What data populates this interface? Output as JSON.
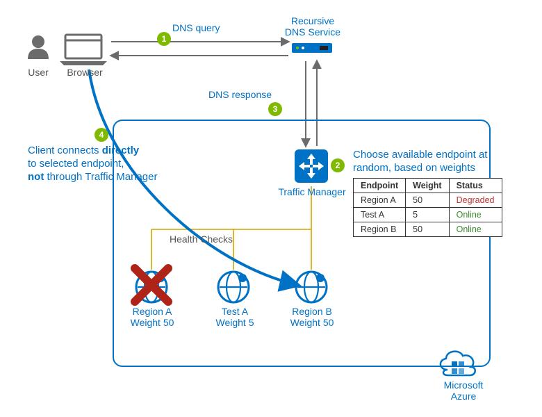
{
  "colors": {
    "azure_blue": "#0072c6",
    "accent_green": "#7fba00",
    "gray": "#6b6b6b",
    "cross_red": "#b02318",
    "degraded": "#c0322f",
    "online": "#3b8a2e"
  },
  "actors": {
    "user": "User",
    "browser": "Browser"
  },
  "dns": {
    "service": "Recursive\nDNS Service",
    "query_label": "DNS query",
    "response_label": "DNS response"
  },
  "traffic_manager": {
    "label": "Traffic Manager",
    "choose_text": "Choose available endpoint at random, based on weights",
    "health_checks_label": "Health Checks"
  },
  "client_note": {
    "line1": "Client connects ",
    "bold1": "directly",
    "line2": "to selected endpoint,",
    "bold2": "not",
    "line2_tail": " through Traffic Manager"
  },
  "steps": {
    "1": "1",
    "2": "2",
    "3": "3",
    "4": "4"
  },
  "endpoints_table": {
    "headers": {
      "endpoint": "Endpoint",
      "weight": "Weight",
      "status": "Status"
    },
    "rows": [
      {
        "endpoint": "Region A",
        "weight": "50",
        "status": "Degraded",
        "status_class": "degraded"
      },
      {
        "endpoint": "Test A",
        "weight": "5",
        "status": "Online",
        "status_class": "online"
      },
      {
        "endpoint": "Region B",
        "weight": "50",
        "status": "Online",
        "status_class": "online"
      }
    ]
  },
  "clusters": [
    {
      "name": "Region A",
      "weight_label": "Weight 50",
      "failed": true
    },
    {
      "name": "Test A",
      "weight_label": "Weight 5",
      "failed": false
    },
    {
      "name": "Region B",
      "weight_label": "Weight 50",
      "failed": false
    }
  ],
  "azure_logo": "Microsoft\nAzure"
}
